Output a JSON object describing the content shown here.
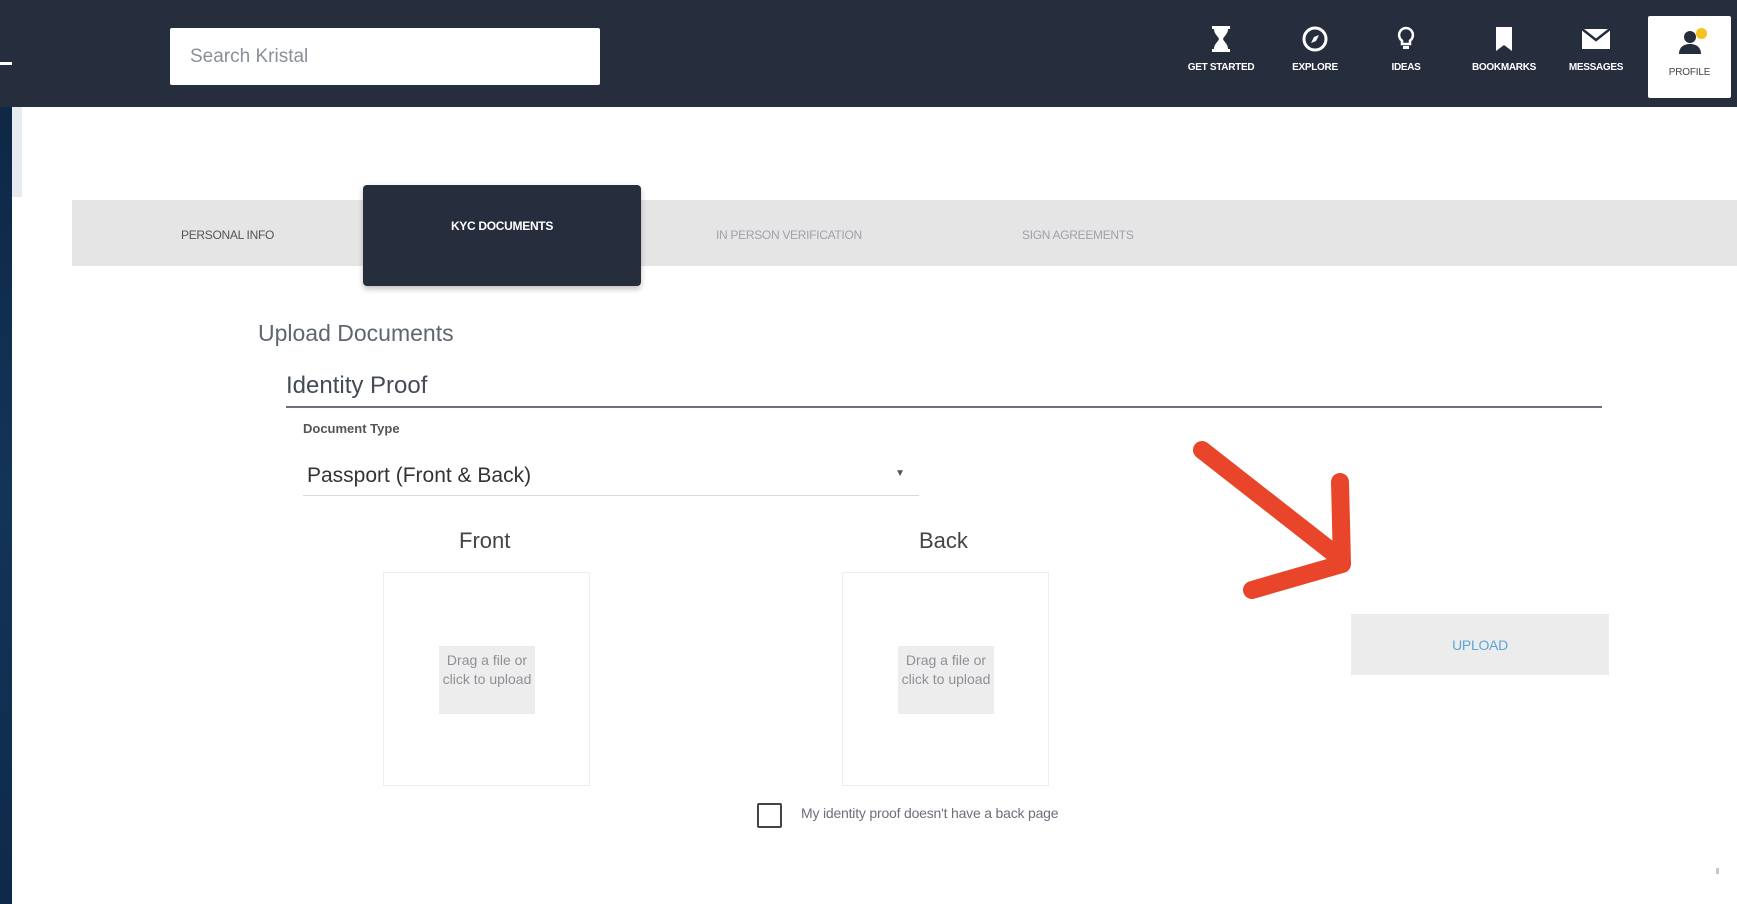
{
  "header": {
    "search_placeholder": "Search Kristal",
    "nav": [
      {
        "label": "GET STARTED",
        "icon": "hourglass-icon"
      },
      {
        "label": "EXPLORE",
        "icon": "compass-icon"
      },
      {
        "label": "IDEAS",
        "icon": "lightbulb-icon"
      },
      {
        "label": "BOOKMARKS",
        "icon": "bookmark-icon"
      },
      {
        "label": "MESSAGES",
        "icon": "envelope-icon"
      },
      {
        "label": "PROFILE",
        "icon": "user-icon"
      }
    ]
  },
  "tabs": [
    {
      "label": "PERSONAL INFO"
    },
    {
      "label": "KYC DOCUMENTS",
      "active": true
    },
    {
      "label": "IN PERSON VERIFICATION"
    },
    {
      "label": "SIGN AGREEMENTS"
    }
  ],
  "main": {
    "heading": "Upload Documents",
    "section_title": "Identity Proof",
    "document_type_label": "Document Type",
    "document_type_value": "Passport (Front & Back)",
    "front_label": "Front",
    "back_label": "Back",
    "dropzone_hint": "Drag a file or click to upload",
    "upload_button": "UPLOAD",
    "no_back_page_label": "My identity proof doesn't have a back page"
  },
  "colors": {
    "header_bg": "#262d3d",
    "frame_bg": "#0f2a47",
    "upload_text": "#5aa7d6",
    "annotation_arrow": "#e8452a",
    "notification_dot": "#f6c21c"
  }
}
